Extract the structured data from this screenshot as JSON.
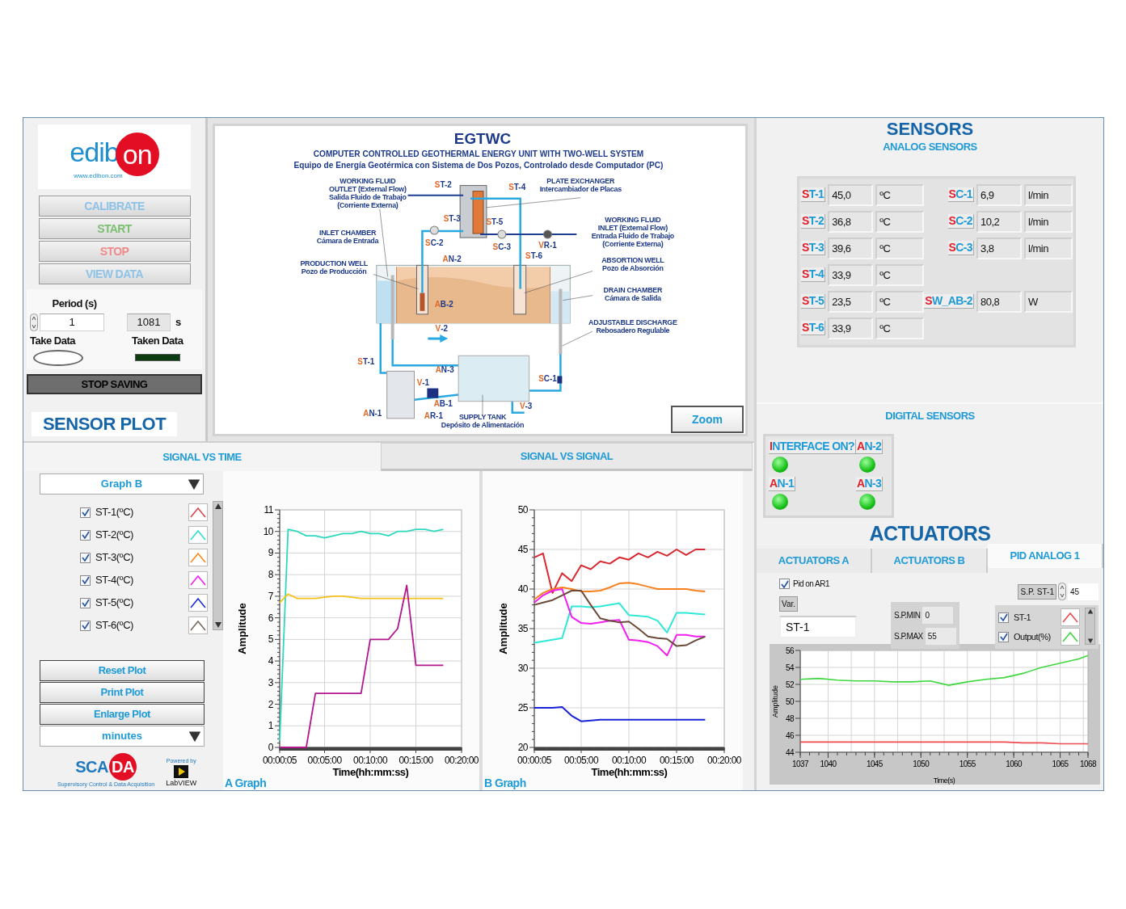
{
  "logo": {
    "name": "edibon",
    "url": "www.edibon.com"
  },
  "control_buttons": [
    {
      "label": "CALIBRATE",
      "color": "#8ec2e6"
    },
    {
      "label": "START",
      "color": "#7cbf72"
    },
    {
      "label": "STOP",
      "color": "#ee8a8a"
    },
    {
      "label": "VIEW DATA",
      "color": "#8ec2e6"
    }
  ],
  "period": {
    "label": "Period (s)",
    "value": "1",
    "elapsed": "1081",
    "unit": "s"
  },
  "take_data": {
    "label": "Take Data",
    "on": false
  },
  "taken_data": {
    "label": "Taken Data",
    "on": false
  },
  "stop_saving": "STOP SAVING",
  "diagram": {
    "title": "EGTWC",
    "subtitle": "COMPUTER CONTROLLED GEOTHERMAL ENERGY UNIT WITH TWO-WELL SYSTEM",
    "subtitle_es": "Equipo de Energía Geotérmica con Sistema de Dos Pozos, Controlado desde Computador (PC)",
    "captions": [
      {
        "lines": [
          "WORKING FLUID",
          "OUTLET (External Flow)",
          "Salida Fluido de Trabajo",
          "(Corriente Externa)"
        ]
      },
      {
        "lines": [
          "PLATE EXCHANGER",
          "Intercambiador de Placas"
        ]
      },
      {
        "lines": [
          "INLET CHAMBER",
          "Cámara de Entrada"
        ]
      },
      {
        "lines": [
          "WORKING FLUID",
          "INLET (External Flow)",
          "Entrada Fluido de Trabajo",
          "(Corriente Externa)"
        ]
      },
      {
        "lines": [
          "PRODUCTION WELL",
          "Pozo de Producción"
        ]
      },
      {
        "lines": [
          "ABSORTION WELL",
          "Pozo de Absorción"
        ]
      },
      {
        "lines": [
          "DRAIN CHAMBER",
          "Cámara de Salida"
        ]
      },
      {
        "lines": [
          "ADJUSTABLE DISCHARGE",
          "Rebosadero Regulable"
        ]
      },
      {
        "lines": [
          "SUPPLY TANK",
          "Depósito de Alimentación"
        ]
      }
    ],
    "tags": [
      "ST-2",
      "ST-4",
      "ST-3",
      "ST-5",
      "SC-2",
      "SC-3",
      "VR-1",
      "AN-2",
      "ST-6",
      "AB-2",
      "V-2",
      "ST-1",
      "AN-3",
      "V-1",
      "SC-1",
      "AB-1",
      "V-3",
      "AN-1",
      "AR-1"
    ],
    "zoom_button": "Zoom"
  },
  "sensor_plot": {
    "title": "SENSOR PLOT",
    "tabs": [
      {
        "label": "SIGNAL VS TIME",
        "selected": true
      },
      {
        "label": "SIGNAL VS SIGNAL",
        "selected": false
      }
    ],
    "graph_select": "Graph B",
    "legend": [
      {
        "label": "ST-1(ºC)",
        "checked": true,
        "color": "#d9474b"
      },
      {
        "label": "ST-2(ºC)",
        "checked": true,
        "color": "#2ee0d0"
      },
      {
        "label": "ST-3(ºC)",
        "checked": true,
        "color": "#f7891e"
      },
      {
        "label": "ST-4(ºC)",
        "checked": true,
        "color": "#f21ff0"
      },
      {
        "label": "ST-5(ºC)",
        "checked": true,
        "color": "#1a2fd6"
      },
      {
        "label": "ST-6(ºC)",
        "checked": true,
        "color": "#7a6a60"
      }
    ],
    "buttons": [
      "Reset Plot",
      "Print Plot",
      "Enlarge Plot"
    ],
    "time_unit": "minutes",
    "graphs": [
      {
        "chart_data": {
          "type": "line",
          "title": "A Graph",
          "xlabel": "Time(hh:mm:ss)",
          "ylabel": "Amplitude",
          "grid": true,
          "x": [
            5,
            60,
            120,
            180,
            240,
            300,
            360,
            420,
            480,
            540,
            600,
            660,
            720,
            780,
            840,
            900,
            960,
            1020,
            1080
          ],
          "series": [
            {
              "color": "#2ed8bd",
              "values": [
                0.3,
                10.1,
                10,
                9.8,
                9.8,
                9.7,
                9.8,
                9.9,
                9.9,
                10,
                9.9,
                9.9,
                9.8,
                10,
                10,
                10.1,
                10.1,
                10,
                10.1
              ]
            },
            {
              "color": "#f5c21b",
              "values": [
                6.7,
                7.1,
                6.9,
                6.9,
                6.9,
                6.95,
                7,
                7,
                6.95,
                6.9,
                6.9,
                6.9,
                6.9,
                6.9,
                6.9,
                6.9,
                6.9,
                6.9,
                6.9
              ]
            },
            {
              "color": "#b3168f",
              "values": [
                0,
                0,
                0,
                0,
                2.5,
                2.5,
                2.5,
                2.5,
                2.5,
                2.5,
                5,
                5,
                5,
                5.5,
                7.5,
                3.8,
                3.8,
                3.8,
                3.8
              ]
            }
          ],
          "xlim": [
            5,
            1200
          ],
          "ylim": [
            0,
            11
          ],
          "xticks": [
            {
              "value": 5,
              "label": "00:00:05"
            },
            {
              "value": 300,
              "label": "00:05:00"
            },
            {
              "value": 600,
              "label": "00:10:00"
            },
            {
              "value": 900,
              "label": "00:15:00"
            },
            {
              "value": 1200,
              "label": "00:20:00"
            }
          ],
          "yticks": [
            {
              "value": 0,
              "label": "0"
            },
            {
              "value": 1,
              "label": "1"
            },
            {
              "value": 2,
              "label": "2"
            },
            {
              "value": 3,
              "label": "3"
            },
            {
              "value": 4,
              "label": "4"
            },
            {
              "value": 5,
              "label": "5"
            },
            {
              "value": 6,
              "label": "6"
            },
            {
              "value": 7,
              "label": "7"
            },
            {
              "value": 8,
              "label": "8"
            },
            {
              "value": 9,
              "label": "9"
            },
            {
              "value": 10,
              "label": "10"
            },
            {
              "value": 11,
              "label": "11"
            }
          ]
        }
      },
      {
        "chart_data": {
          "type": "line",
          "title": "B Graph",
          "xlabel": "Time(hh:mm:ss)",
          "ylabel": "Amplitude",
          "grid": true,
          "x": [
            5,
            60,
            120,
            180,
            240,
            300,
            360,
            420,
            480,
            540,
            600,
            660,
            720,
            780,
            840,
            900,
            960,
            1020,
            1080
          ],
          "series": [
            {
              "color": "#d9282f",
              "values": [
                44,
                44.5,
                39.5,
                42,
                41,
                43,
                42.5,
                43.5,
                43.2,
                44,
                43.7,
                44.5,
                44,
                44.7,
                44.2,
                45,
                44.3,
                45,
                45
              ]
            },
            {
              "color": "#2ee8d8",
              "values": [
                33.2,
                33.4,
                33.6,
                33.8,
                37.8,
                37.8,
                37.7,
                37.8,
                38,
                38.2,
                36.7,
                36.6,
                36.5,
                36,
                34.5,
                37,
                37,
                36.9,
                36.8
              ]
            },
            {
              "color": "#f7801e",
              "values": [
                38.7,
                39.5,
                40,
                40.2,
                40,
                39.7,
                39.7,
                39.8,
                40.2,
                40.7,
                40.8,
                40.6,
                40.3,
                40,
                40,
                40,
                40,
                39.8,
                39.7
              ]
            },
            {
              "color": "#f21ff0",
              "values": [
                38.3,
                39.2,
                39.8,
                40,
                36.5,
                35.7,
                35.6,
                35.8,
                36,
                36.1,
                33.6,
                33.5,
                33.3,
                32.8,
                31.6,
                34.2,
                34.2,
                34,
                34
              ]
            },
            {
              "color": "#1a22d6",
              "values": [
                25,
                25,
                25,
                25.1,
                24,
                23.3,
                23.4,
                23.5,
                23.5,
                23.5,
                23.5,
                23.5,
                23.5,
                23.5,
                23.5,
                23.5,
                23.5,
                23.5,
                23.5
              ]
            },
            {
              "color": "#6b4a3a",
              "values": [
                38,
                38.3,
                38.6,
                39.2,
                39.8,
                39.8,
                38,
                36.3,
                36,
                35.8,
                35.9,
                35,
                34,
                33.8,
                33.7,
                32.8,
                32.9,
                33.5,
                34
              ]
            }
          ],
          "xlim": [
            5,
            1200
          ],
          "ylim": [
            20,
            50
          ],
          "xticks": [
            {
              "value": 5,
              "label": "00:00:05"
            },
            {
              "value": 300,
              "label": "00:05:00"
            },
            {
              "value": 600,
              "label": "00:10:00"
            },
            {
              "value": 900,
              "label": "00:15:00"
            },
            {
              "value": 1200,
              "label": "00:20:00"
            }
          ],
          "yticks": [
            {
              "value": 20,
              "label": "20"
            },
            {
              "value": 25,
              "label": "25"
            },
            {
              "value": 30,
              "label": "30"
            },
            {
              "value": 35,
              "label": "35"
            },
            {
              "value": 40,
              "label": "40"
            },
            {
              "value": 45,
              "label": "45"
            },
            {
              "value": 50,
              "label": "50"
            }
          ]
        }
      }
    ]
  },
  "footer_logos": {
    "scada": "SCADA",
    "scada_tagline": "Supervisory Control & Data Acquisition",
    "powered_by": "Powered by",
    "labview": "LabVIEW"
  },
  "sensors": {
    "title": "SENSORS",
    "analog_title": "ANALOG SENSORS",
    "temperatures": [
      {
        "tag": "ST-1",
        "value": "45,0",
        "unit": "ºC"
      },
      {
        "tag": "ST-2",
        "value": "36,8",
        "unit": "ºC"
      },
      {
        "tag": "ST-3",
        "value": "39,6",
        "unit": "ºC"
      },
      {
        "tag": "ST-4",
        "value": "33,9",
        "unit": "ºC"
      },
      {
        "tag": "ST-5",
        "value": "23,5",
        "unit": "ºC"
      },
      {
        "tag": "ST-6",
        "value": "33,9",
        "unit": "ºC"
      }
    ],
    "flows": [
      {
        "tag": "SC-1",
        "value": "6,9",
        "unit": "l/min"
      },
      {
        "tag": "SC-2",
        "value": "10,2",
        "unit": "l/min"
      },
      {
        "tag": "SC-3",
        "value": "3,8",
        "unit": "l/min"
      }
    ],
    "power": [
      {
        "tag": "SW_AB-2",
        "value": "80,8",
        "unit": "W"
      }
    ],
    "digital_title": "DIGITAL SENSORS",
    "digital": [
      {
        "tag": "INTERFACE ON?",
        "on": true
      },
      {
        "tag": "AN-2",
        "on": true
      },
      {
        "tag": "AN-1",
        "on": true
      },
      {
        "tag": "AN-3",
        "on": true
      }
    ]
  },
  "actuators": {
    "title": "ACTUATORS",
    "tabs": [
      {
        "label": "ACTUATORS A",
        "selected": false
      },
      {
        "label": "ACTUATORS B",
        "selected": false
      },
      {
        "label": "PID ANALOG 1",
        "selected": true
      }
    ],
    "pid": {
      "enable": {
        "label": "Pid on AR1",
        "checked": true
      },
      "var_label": "Var.",
      "var_value": "ST-1",
      "sp_min": {
        "label": "S.P.MIN",
        "value": "0"
      },
      "sp_max": {
        "label": "S.P.MAX",
        "value": "55"
      },
      "setpoint": {
        "label": "S.P. ST-1",
        "value": "45"
      },
      "legend": [
        {
          "label": "ST-1",
          "checked": true,
          "color": "#ee4c50"
        },
        {
          "label": "Output(%)",
          "checked": true,
          "color": "#3ed83e"
        }
      ],
      "chart_data": {
        "type": "line",
        "xlabel": "Time(s)",
        "ylabel": "Amplitude",
        "grid": true,
        "x": [
          1037,
          1039,
          1041,
          1043,
          1045,
          1047,
          1049,
          1051,
          1053,
          1055,
          1057,
          1059,
          1061,
          1063,
          1065,
          1067,
          1068
        ],
        "series": [
          {
            "color": "#ee4c50",
            "values": [
              45.2,
              45.2,
              45.2,
              45.2,
              45.2,
              45.2,
              45.2,
              45.2,
              45.2,
              45.2,
              45.2,
              45.2,
              45.1,
              45.1,
              45,
              45,
              45
            ]
          },
          {
            "color": "#3ed83e",
            "values": [
              52.6,
              52.7,
              52.5,
              52.4,
              52.4,
              52.3,
              52.3,
              52.4,
              51.9,
              52.3,
              52.6,
              52.8,
              53.3,
              54,
              54.5,
              55,
              55.4
            ]
          }
        ],
        "xlim": [
          1037,
          1068
        ],
        "ylim": [
          44,
          56
        ],
        "xticks": [
          1037,
          1040,
          1045,
          1050,
          1055,
          1060,
          1065,
          1068
        ],
        "yticks": [
          44,
          46,
          48,
          50,
          52,
          54,
          56
        ]
      }
    }
  }
}
